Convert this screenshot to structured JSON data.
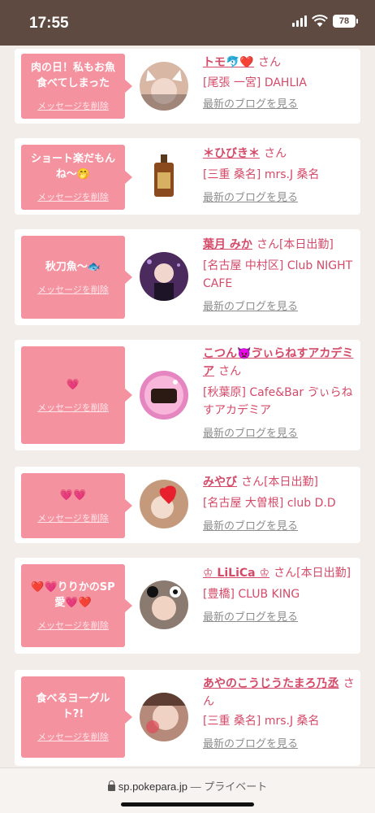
{
  "status": {
    "time": "17:55",
    "battery": "78"
  },
  "common": {
    "delete_label": "メッセージを削除",
    "blog_label": "最新のブログを見る",
    "san": "さん"
  },
  "cards": [
    {
      "message": "肉の日！私もお魚食べてしまった",
      "name": "トモ🐬❤️",
      "tag": "",
      "shop": "[尾張 一宮] DAHLIA",
      "avatar_color": "#d8b7a5"
    },
    {
      "message": "ショート楽だもんね〜🤭",
      "name": "＊ひびき＊",
      "tag": "",
      "shop": "[三重 桑名] mrs.J 桑名",
      "avatar_color": "#8b4a1d"
    },
    {
      "message": "秋刀魚〜🐟",
      "name": "葉月 みか",
      "tag": "[本日出勤]",
      "shop": "[名古屋 中村区] Club NIGHT CAFE",
      "avatar_color": "#4b2a5e"
    },
    {
      "message": "💗",
      "name": "こつん👿ゔぃらねすアカデミア",
      "tag": "",
      "shop": "[秋葉原] Cafe&Bar ゔぃらねすアカデミア",
      "avatar_color": "#e586c0"
    },
    {
      "message": "💗💗",
      "name": "みやび",
      "tag": "[本日出勤]",
      "shop": "[名古屋 大曽根] club D.D",
      "avatar_color": "#c59a7c"
    },
    {
      "message": "❤️💗りりかのSP愛💗❤️",
      "name": "♔ LiLiCa ♔",
      "tag": "[本日出勤]",
      "shop": "[豊橋] CLUB KING",
      "avatar_color": "#8a7a70"
    },
    {
      "message": "食べるヨーグルト?!",
      "name": "あやのこうじうたまろ乃丞",
      "tag": "",
      "shop": "[三重 桑名] mrs.J 桑名",
      "avatar_color": "#b58a7a"
    }
  ],
  "browser": {
    "url": "sp.pokepara.jp",
    "mode": "— プライベート"
  }
}
